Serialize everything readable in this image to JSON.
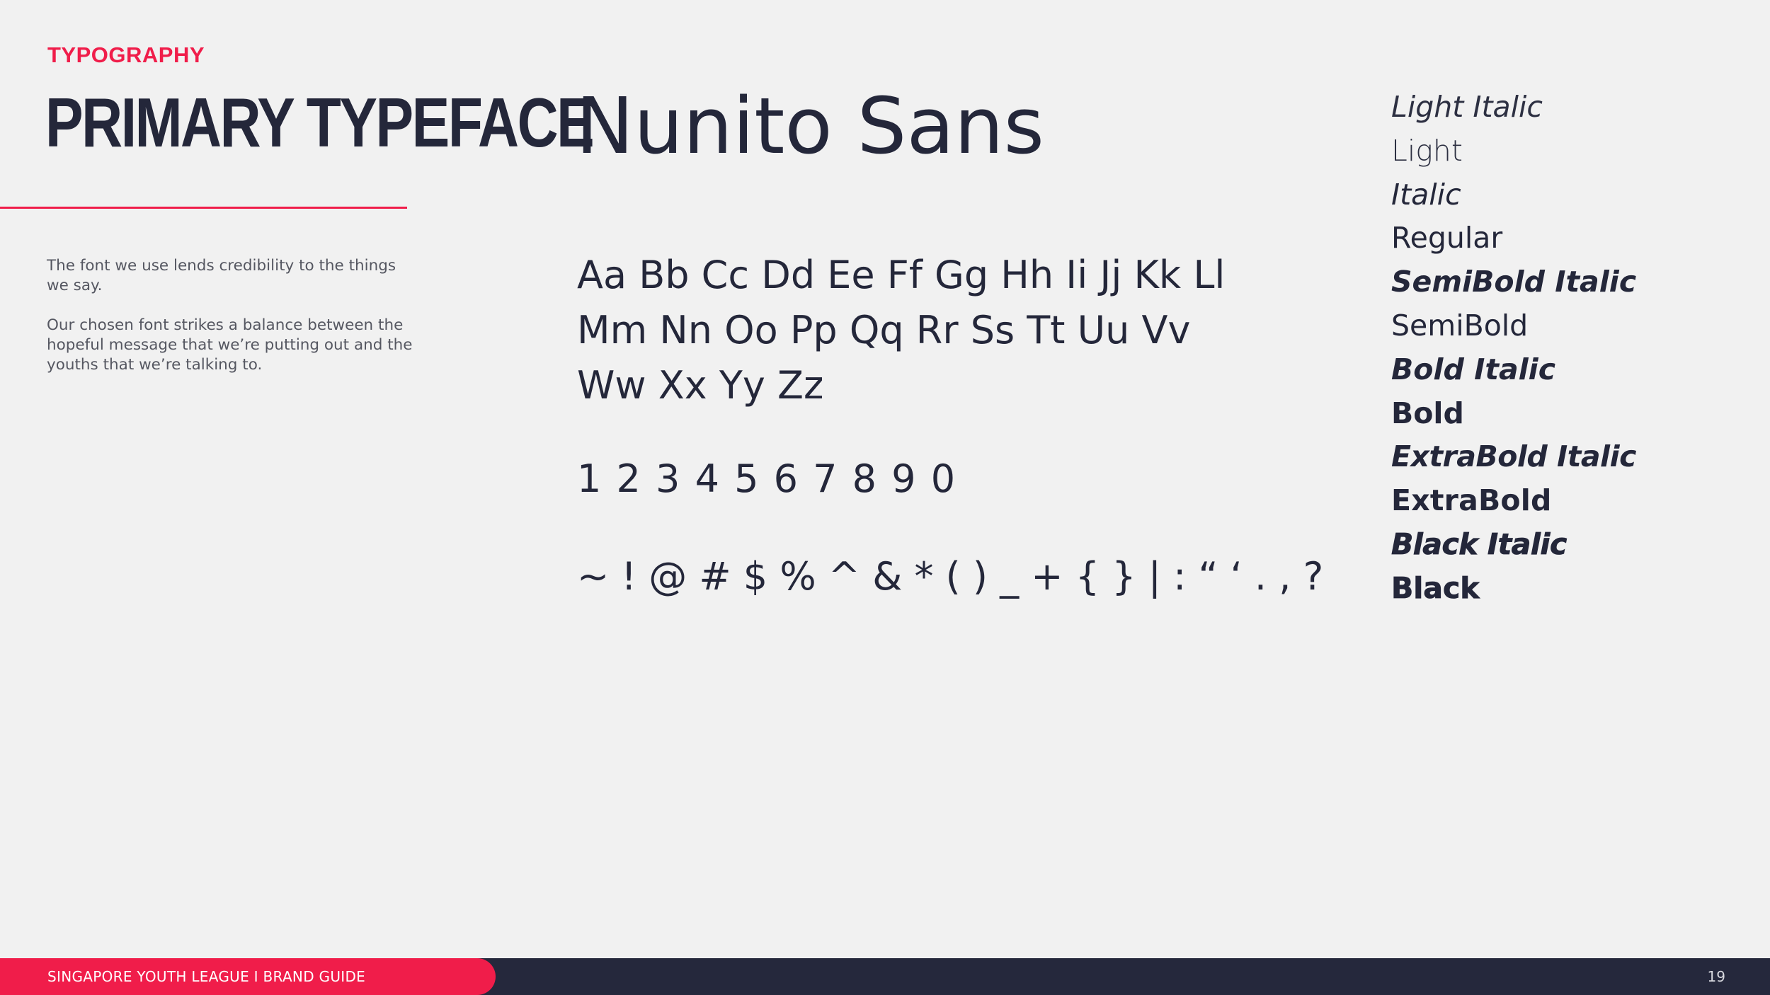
{
  "header": {
    "section_label": "TYPOGRAPHY",
    "title": "PRIMARY TYPEFACE"
  },
  "intro": {
    "paragraphs": [
      "The font we use lends credibility to the things we say.",
      "Our chosen font strikes a balance between the hopeful message that we’re putting out and the youths that we’re talking to."
    ]
  },
  "specimen": {
    "font_name": "Nunito Sans",
    "alphabet_lines": [
      "Aa Bb Cc Dd Ee Ff Gg Hh Ii Jj Kk Ll",
      "Mm Nn Oo Pp Qq Rr Ss Tt Uu Vv",
      "Ww Xx Yy Zz"
    ],
    "numerals": "1 2 3 4 5 6 7 8 9 0",
    "symbols": "~ ! @ # $ % ^ & * ( ) _ + { } | : “ ‘ . , ?"
  },
  "weights": [
    "Light Italic",
    "Light",
    "Italic",
    "Regular",
    "SemiBold Italic",
    "SemiBold",
    "Bold Italic",
    "Bold",
    "ExtraBold Italic",
    "ExtraBold",
    "Black Italic",
    "Black"
  ],
  "footer": {
    "text": "SINGAPORE YOUTH LEAGUE  I  BRAND GUIDE",
    "page_number": "19"
  },
  "colors": {
    "accent": "#f01d4a",
    "navy": "#24273a",
    "background": "#f1f1f1"
  }
}
